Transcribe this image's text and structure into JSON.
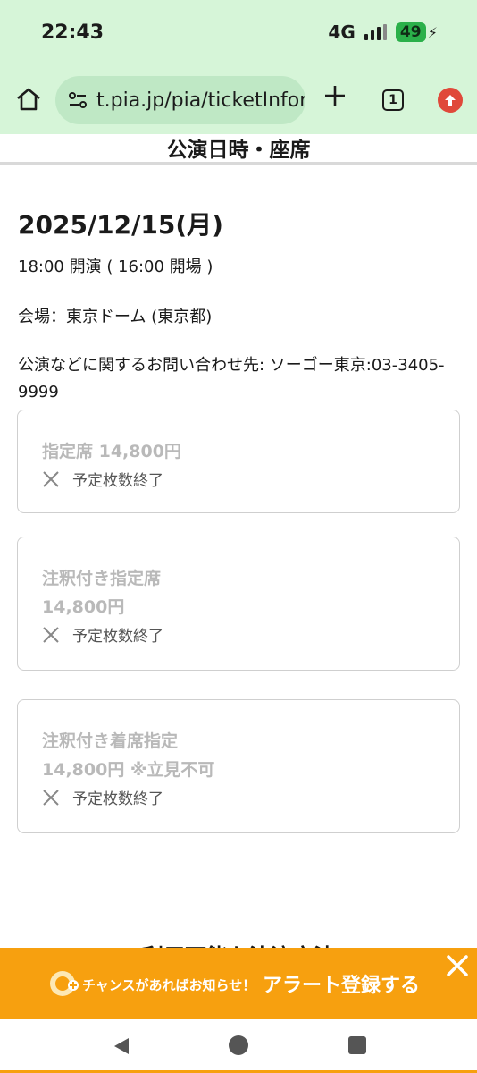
{
  "status": {
    "time": "22:43",
    "network": "4G",
    "battery": "49"
  },
  "browser": {
    "url": "t.pia.jp/pia/ticketInfor",
    "tab_count": "1"
  },
  "section_title": "公演日時・座席",
  "performance": {
    "date": "2025/12/15(月)",
    "time": "18:00 開演 ( 16:00 開場 )",
    "venue": "会場：東京ドーム (東京都)",
    "contact": "公演などに関するお問い合わせ先: ソーゴー東京:03-3405-9999"
  },
  "seats": [
    {
      "name": "指定席 14,800円",
      "price": "",
      "status": "予定枚数終了"
    },
    {
      "name": "注釈付き指定席",
      "price": "14,800円",
      "status": "予定枚数終了"
    },
    {
      "name": "注釈付き着席指定",
      "price": "14,800円 ※立見不可",
      "status": "予定枚数終了"
    }
  ],
  "next_section": "利用可能な決済方法",
  "alert": {
    "small": "チャンスがあればお知らせ！",
    "main": "アラート登録する"
  },
  "colors": {
    "browser_bg": "#d6f5d8",
    "alert_bg": "#f7a00f",
    "disabled_text": "#b9b9b9"
  }
}
